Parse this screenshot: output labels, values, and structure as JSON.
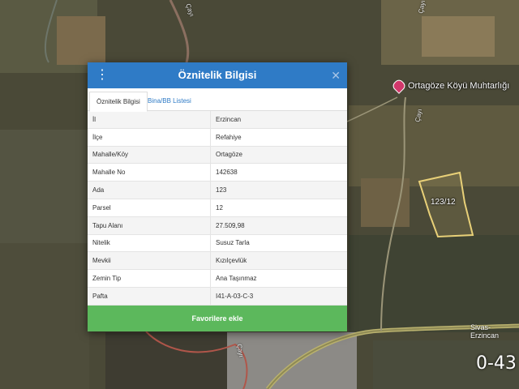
{
  "map": {
    "poi_label": "Ortagöze Köyü Muhtarlığı",
    "parcel_label": "123/12",
    "road_label": "Sivas-Erzincan",
    "river_labels": [
      "Çayı",
      "Çayı",
      "Çayı",
      "Çayı"
    ],
    "corner_code": "0-43"
  },
  "dialog": {
    "title": "Öznitelik Bilgisi",
    "menu_glyph": "⋮",
    "close_glyph": "✕",
    "tabs": [
      {
        "label": "Öznitelik Bilgisi"
      },
      {
        "label": "Bina/BB Listesi"
      }
    ],
    "rows": [
      {
        "key": "İl",
        "value": "Erzincan"
      },
      {
        "key": "İlçe",
        "value": "Refahiye"
      },
      {
        "key": "Mahalle/Köy",
        "value": "Ortagöze"
      },
      {
        "key": "Mahalle No",
        "value": "142638"
      },
      {
        "key": "Ada",
        "value": "123"
      },
      {
        "key": "Parsel",
        "value": "12"
      },
      {
        "key": "Tapu Alanı",
        "value": "27.509,98"
      },
      {
        "key": "Nitelik",
        "value": "Susuz Tarla"
      },
      {
        "key": "Mevkii",
        "value": "Kızılçevlük"
      },
      {
        "key": "Zemin Tip",
        "value": "Ana Taşınmaz"
      },
      {
        "key": "Pafta",
        "value": "I41-A-03-C-3"
      }
    ],
    "favorite_button": "Favorilere ekle"
  },
  "colors": {
    "header": "#2f7bc6",
    "button": "#5cb85c",
    "parcel_outline": "#e8d078"
  }
}
